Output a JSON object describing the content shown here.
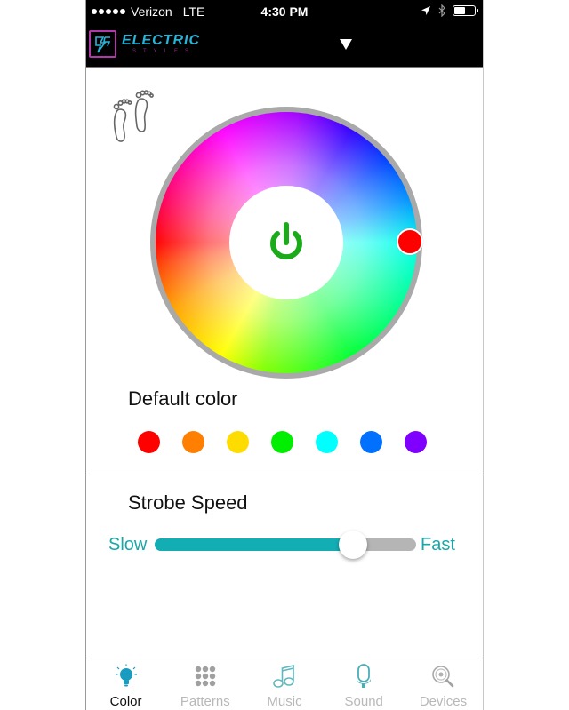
{
  "status_bar": {
    "carrier": "Verizon",
    "network": "LTE",
    "time": "4:30 PM",
    "signal_bars": 5,
    "battery_level": 0.6,
    "icons": [
      "location-arrow-icon",
      "bluetooth-icon",
      "battery-icon"
    ]
  },
  "header": {
    "logo_title": "ELECTRIC",
    "logo_subtitle": "STYLES",
    "dropdown_icon": "triangle-down-icon"
  },
  "colors": {
    "accent": "#12aeb4",
    "power_green": "#1aaa1a",
    "slider_track": "#b5b5b5",
    "selected_wheel_color": "#ff0000"
  },
  "color_wheel": {
    "power_icon": "power-icon",
    "selected_color": "#ff0000"
  },
  "default_color": {
    "title": "Default color",
    "swatches": [
      {
        "name": "red",
        "color": "#ff0000"
      },
      {
        "name": "orange",
        "color": "#ff8000"
      },
      {
        "name": "yellow",
        "color": "#ffdc00"
      },
      {
        "name": "green",
        "color": "#00ee00"
      },
      {
        "name": "cyan",
        "color": "#00ffff"
      },
      {
        "name": "blue",
        "color": "#0070ff"
      },
      {
        "name": "purple",
        "color": "#8000ff"
      }
    ]
  },
  "strobe": {
    "title": "Strobe Speed",
    "min_label": "Slow",
    "max_label": "Fast",
    "value_fraction": 0.76
  },
  "tabs": [
    {
      "label": "Color",
      "icon": "lightbulb-icon",
      "active": true
    },
    {
      "label": "Patterns",
      "icon": "grid-dots-icon",
      "active": false
    },
    {
      "label": "Music",
      "icon": "music-note-icon",
      "active": false
    },
    {
      "label": "Sound",
      "icon": "microphone-icon",
      "active": false
    },
    {
      "label": "Devices",
      "icon": "search-devices-icon",
      "active": false
    }
  ]
}
